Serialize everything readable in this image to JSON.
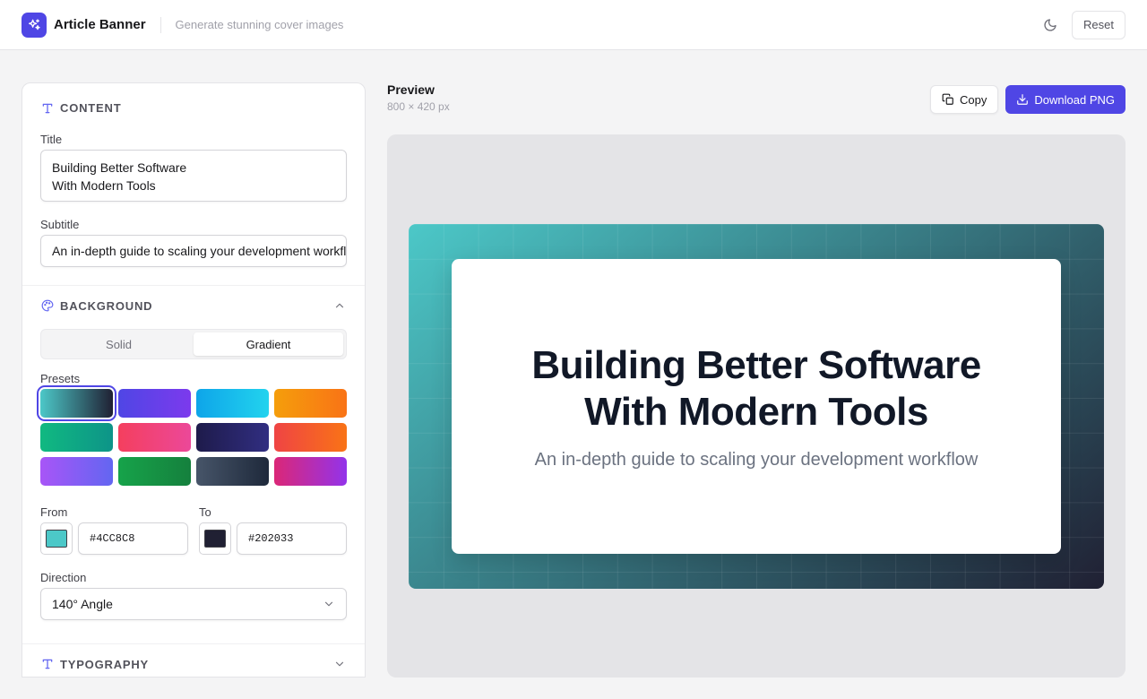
{
  "header": {
    "app_name": "Article Banner",
    "tagline": "Generate stunning cover images",
    "theme_icon": "moon-icon",
    "reset_label": "Reset"
  },
  "content": {
    "section_title": "CONTENT",
    "title_label": "Title",
    "title_value": "Building Better Software\nWith Modern Tools",
    "subtitle_label": "Subtitle",
    "subtitle_value": "An in-depth guide to scaling your development workflow"
  },
  "background": {
    "section_title": "BACKGROUND",
    "mode_options": [
      "Solid",
      "Gradient"
    ],
    "selected_mode": "Gradient",
    "presets_label": "Presets",
    "presets": [
      {
        "from": "#4CC8C8",
        "to": "#202033",
        "selected": true
      },
      {
        "from": "#4F46E5",
        "to": "#7C3AED",
        "selected": false
      },
      {
        "from": "#0EA5E9",
        "to": "#22D3EE",
        "selected": false
      },
      {
        "from": "#F59E0B",
        "to": "#F97316",
        "selected": false
      },
      {
        "from": "#10B981",
        "to": "#0D9488",
        "selected": false
      },
      {
        "from": "#F43F5E",
        "to": "#EC4899",
        "selected": false
      },
      {
        "from": "#1E1B4B",
        "to": "#312E81",
        "selected": false
      },
      {
        "from": "#EF4444",
        "to": "#F97316",
        "selected": false
      },
      {
        "from": "#A855F7",
        "to": "#6366F1",
        "selected": false
      },
      {
        "from": "#16A34A",
        "to": "#15803D",
        "selected": false
      },
      {
        "from": "#475569",
        "to": "#1E293B",
        "selected": false
      },
      {
        "from": "#DB2777",
        "to": "#9333EA",
        "selected": false
      }
    ],
    "from_label": "From",
    "from_color": "#4CC8C8",
    "from_hex": "#4CC8C8",
    "to_label": "To",
    "to_color": "#202033",
    "to_hex": "#202033",
    "direction_label": "Direction",
    "direction_value": "140° Angle"
  },
  "typography": {
    "section_title": "TYPOGRAPHY"
  },
  "preview": {
    "title": "Preview",
    "dimensions": "800 × 420 px",
    "copy_label": "Copy",
    "download_label": "Download PNG",
    "banner_title": "Building Better Software\nWith Modern Tools",
    "banner_subtitle": "An in-depth guide to scaling your development workflow"
  },
  "colors": {
    "accent": "#4F46E5"
  }
}
